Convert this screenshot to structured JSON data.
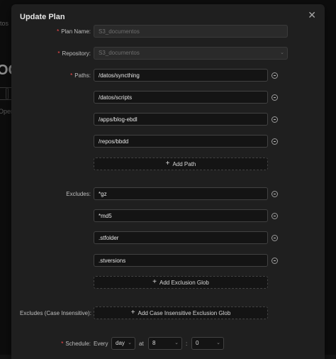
{
  "background": {
    "nav_text": "tos",
    "big_text": "OC",
    "small_text": "Oper"
  },
  "modal": {
    "title": "Update Plan",
    "close_icon": "close-icon"
  },
  "fields": {
    "plan_name": {
      "label": "Plan Name",
      "value": "S3_documentos"
    },
    "repository": {
      "label": "Repository",
      "value": "S3_documentos"
    },
    "paths": {
      "label": "Paths",
      "items": [
        "/datos/syncthing",
        "/datos/scripts",
        "/apps/blog-ebdl",
        "/repos/bbdd"
      ],
      "add_label": "Add Path"
    },
    "excludes": {
      "label": "Excludes",
      "items": [
        "*gz",
        "*md5",
        ".stfolder",
        ".stversions"
      ],
      "add_label": "Add Exclusion Glob"
    },
    "iexcludes": {
      "label": "Excludes (Case Insensitive)",
      "add_label": "Add Case Insensitive Exclusion Glob"
    },
    "schedule": {
      "label": "Schedule",
      "every_text": "Every",
      "unit": "day",
      "at_text": "at",
      "hour": "8",
      "minute": "0",
      "separator": ":"
    }
  },
  "colors": {
    "required_marker": "#ff4d4f",
    "modal_bg": "#1f1f1f",
    "input_bg": "#141414",
    "border": "#424242"
  }
}
